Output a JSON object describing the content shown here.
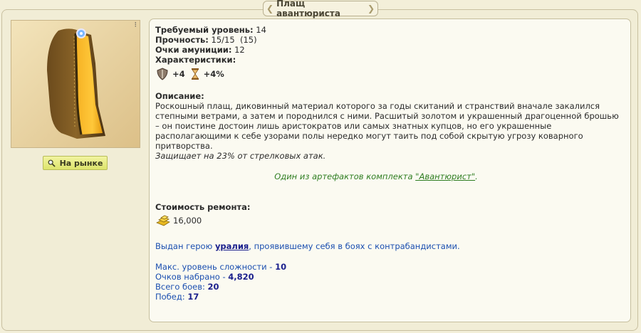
{
  "window": {
    "title": "Плащ авантюриста"
  },
  "item": {
    "image_icon": "cloak-image",
    "market_button_label": "На рынке"
  },
  "requirements": {
    "level_label": "Требуемый уровень:",
    "level_value": "14",
    "durability_label": "Прочность:",
    "durability_value": "15/15  (15)",
    "ammo_label": "Очки амуниции:",
    "ammo_value": "12",
    "stats_label": "Характеристики:",
    "stats": [
      {
        "icon": "defense-shield-icon",
        "value": "+4"
      },
      {
        "icon": "initiative-hourglass-icon",
        "value": "+4%"
      }
    ]
  },
  "description": {
    "heading": "Описание:",
    "lines": [
      "Роскошный плащ, диковинный материал которого за годы скитаний и странствий вначале закалился",
      "степными ветрами, а затем и породнился с ними. Расшитый золотом и украшенный драгоценной брошью",
      "– он поистине достоин лишь аристократов или самых знатных купцов, но его украшенные",
      "располагающими к себе узорами полы нередко могут таить под собой скрытую угрозу коварного",
      "притворства."
    ],
    "protection": "Защищает на 23% от стрелковых атак."
  },
  "set": {
    "prefix": "Один из артефактов комплекта ",
    "link": "\"Авантюрист\"",
    "suffix": "."
  },
  "repair": {
    "label": "Стоимость ремонта:",
    "icon": "gold-icon",
    "value": "16,000"
  },
  "award": {
    "prefix": "Выдан герою ",
    "hero": "уралия",
    "suffix": ", проявившему себя в боях с контрабандистами."
  },
  "stats_summary": [
    {
      "label": "Макс. уровень сложности - ",
      "value": "10"
    },
    {
      "label": "Очков набрано - ",
      "value": "4,820"
    },
    {
      "label": "Всего боев: ",
      "value": "20"
    },
    {
      "label": "Побед: ",
      "value": "17"
    }
  ],
  "colors": {
    "set_text": "#2e7d20",
    "blue_text": "#1b4fb0",
    "button_bg": "#dde46c"
  }
}
